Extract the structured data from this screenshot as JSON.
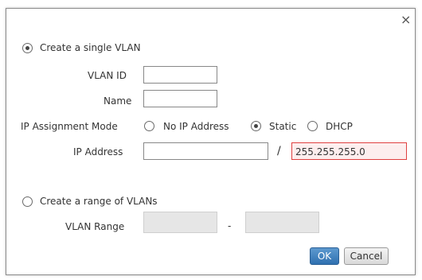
{
  "dialog": {
    "close_glyph": "×"
  },
  "single_vlan": {
    "radio_label": "Create a single VLAN",
    "vlan_id_label": "VLAN ID",
    "vlan_id_value": "",
    "name_label": "Name",
    "name_value": ""
  },
  "ip_mode": {
    "label": "IP Assignment Mode",
    "options": [
      "No IP Address",
      "Static",
      "DHCP"
    ],
    "selected": "Static"
  },
  "ip_address": {
    "label": "IP Address",
    "value": "",
    "separator": "/",
    "mask_value": "255.255.255.0"
  },
  "range": {
    "radio_label": "Create a range of VLANs",
    "vlan_range_label": "VLAN Range",
    "separator": "-",
    "from_value": "",
    "to_value": ""
  },
  "buttons": {
    "ok": "OK",
    "cancel": "Cancel"
  }
}
